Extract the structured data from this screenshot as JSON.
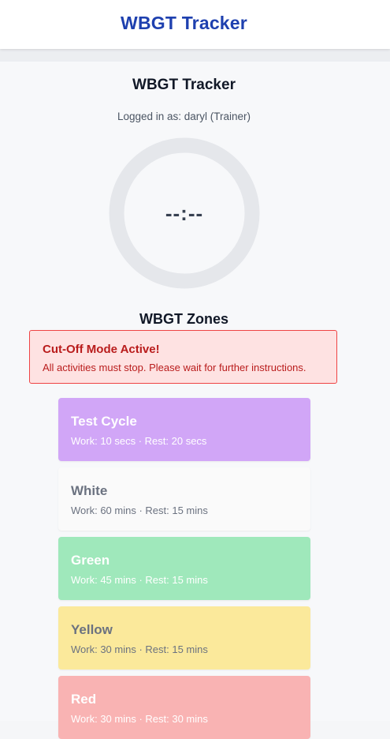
{
  "header": {
    "title": "WBGT Tracker"
  },
  "main": {
    "title": "WBGT Tracker",
    "login_status": "Logged in as: daryl (Trainer)",
    "timer": {
      "display": "--:--",
      "ring_color": "#e5e7eb"
    },
    "zones_title": "WBGT Zones",
    "alert": {
      "title": "Cut-Off Mode Active!",
      "message": "All activities must stop. Please wait for further instructions.",
      "background": "#fee2e2",
      "border": "#ef4444",
      "text_color": "#b91c1c"
    },
    "zones": [
      {
        "name": "Test Cycle",
        "detail": "Work: 10 secs · Rest: 20 secs",
        "background": "#d1a6f7",
        "text_color": "#ffffff"
      },
      {
        "name": "White",
        "detail": "Work: 60 mins · Rest: 15 mins",
        "background": "#fafafa",
        "text_color": "#6b7280"
      },
      {
        "name": "Green",
        "detail": "Work: 45 mins · Rest: 15 mins",
        "background": "#9fe8bb",
        "text_color": "#ffffff"
      },
      {
        "name": "Yellow",
        "detail": "Work: 30 mins · Rest: 15 mins",
        "background": "#fbe99b",
        "text_color": "#6b7280"
      },
      {
        "name": "Red",
        "detail": "Work: 30 mins · Rest: 30 mins",
        "background": "#f9b3b3",
        "text_color": "#ffffff"
      }
    ]
  }
}
